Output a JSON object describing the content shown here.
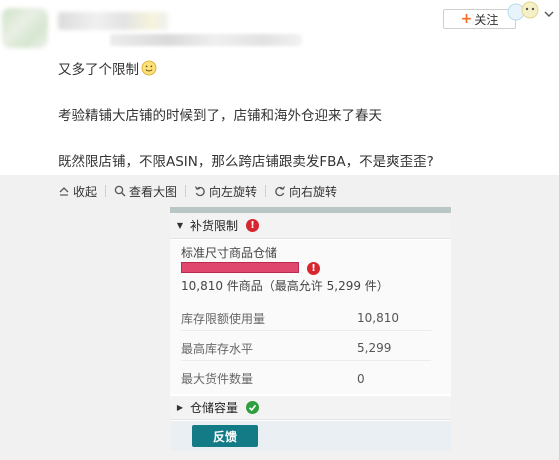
{
  "header": {
    "follow_label": "关注"
  },
  "post": {
    "line1": "又多了个限制",
    "line2": "考验精铺大店铺的时候到了，店铺和海外仓迎来了春天",
    "line3": "既然限店铺，不限ASIN，那么跨店铺跟卖发FBA，不是爽歪歪?"
  },
  "toolbar": {
    "items": [
      {
        "label": "收起",
        "icon": "collapse-icon"
      },
      {
        "label": "查看大图",
        "icon": "search-icon"
      },
      {
        "label": "向左旋转",
        "icon": "rotate-left-icon"
      },
      {
        "label": "向右旋转",
        "icon": "rotate-right-icon"
      }
    ]
  },
  "screenshot": {
    "replenish_title": "补货限制",
    "std_storage_label": "标准尺寸商品仓储",
    "usage_fraction": 1.0,
    "count_text": "10,810 件商品（最高允许 5,299 件）",
    "metrics": [
      {
        "label": "库存限额使用量",
        "value": "10,810"
      },
      {
        "label": "最高库存水平",
        "value": "5,299"
      },
      {
        "label": "最大货件数量",
        "value": "0"
      }
    ],
    "storage_title": "仓储容量",
    "feedback_label": "反馈"
  },
  "colors": {
    "accent_orange": "#f76d1f",
    "alert_red": "#d7262e",
    "ok_green": "#2e9e3e",
    "bar_pink": "#e0476d",
    "feedback_teal": "#137b86"
  }
}
